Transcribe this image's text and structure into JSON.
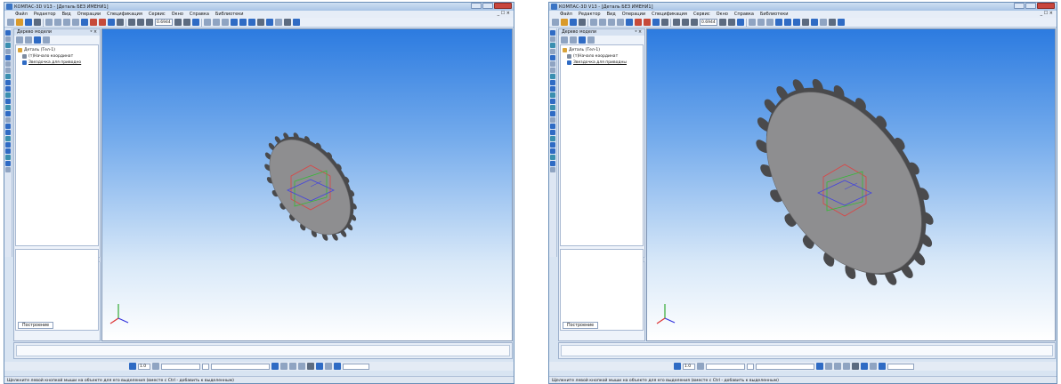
{
  "windows": [
    {
      "title": "КОМПАС-3D V13 - [Деталь БЕЗ ИМЕНИ1]",
      "menu": [
        "Файл",
        "Редактор",
        "Вид",
        "Операции",
        "Спецификация",
        "Сервис",
        "Окно",
        "Справка",
        "Библиотеки"
      ],
      "mdi_controls": "_ ☐ ×",
      "zoom": "0.6944",
      "tree": {
        "header": "Дерево модели",
        "pin": "ᵠ ×",
        "nodes": [
          "Деталь (Тел-1)",
          "(т)Начало координат",
          "Звездочка для приводно"
        ],
        "tab": "Построение"
      },
      "bottom": {
        "step": "1.0"
      },
      "status": "Щелкните левой кнопкой мыши на объекте для его выделения (вместе с Ctrl - добавить к выделенным)"
    },
    {
      "title": "КОМПАС-3D V13 - [Деталь БЕЗ ИМЕНИ1]",
      "menu": [
        "Файл",
        "Редактор",
        "Вид",
        "Операции",
        "Спецификация",
        "Сервис",
        "Окно",
        "Справка",
        "Библиотеки"
      ],
      "mdi_controls": "_ ☐ ×",
      "zoom": "0.6944",
      "tree": {
        "header": "Дерево модели",
        "pin": "ᵠ ×",
        "nodes": [
          "Деталь (Тел-1)",
          "(т)Начало координат",
          "Звездочка для приводны"
        ],
        "tab": "Построение"
      },
      "bottom": {
        "step": "1.0"
      },
      "status": "Щелкните левой кнопкой мыши на объекте для его выделения (вместе с Ctrl - добавить к выделенным)"
    }
  ],
  "colors": {
    "viewport_top": "#2c7be0",
    "gear": "#8e8e90",
    "gear_dark": "#4a4a4c"
  }
}
